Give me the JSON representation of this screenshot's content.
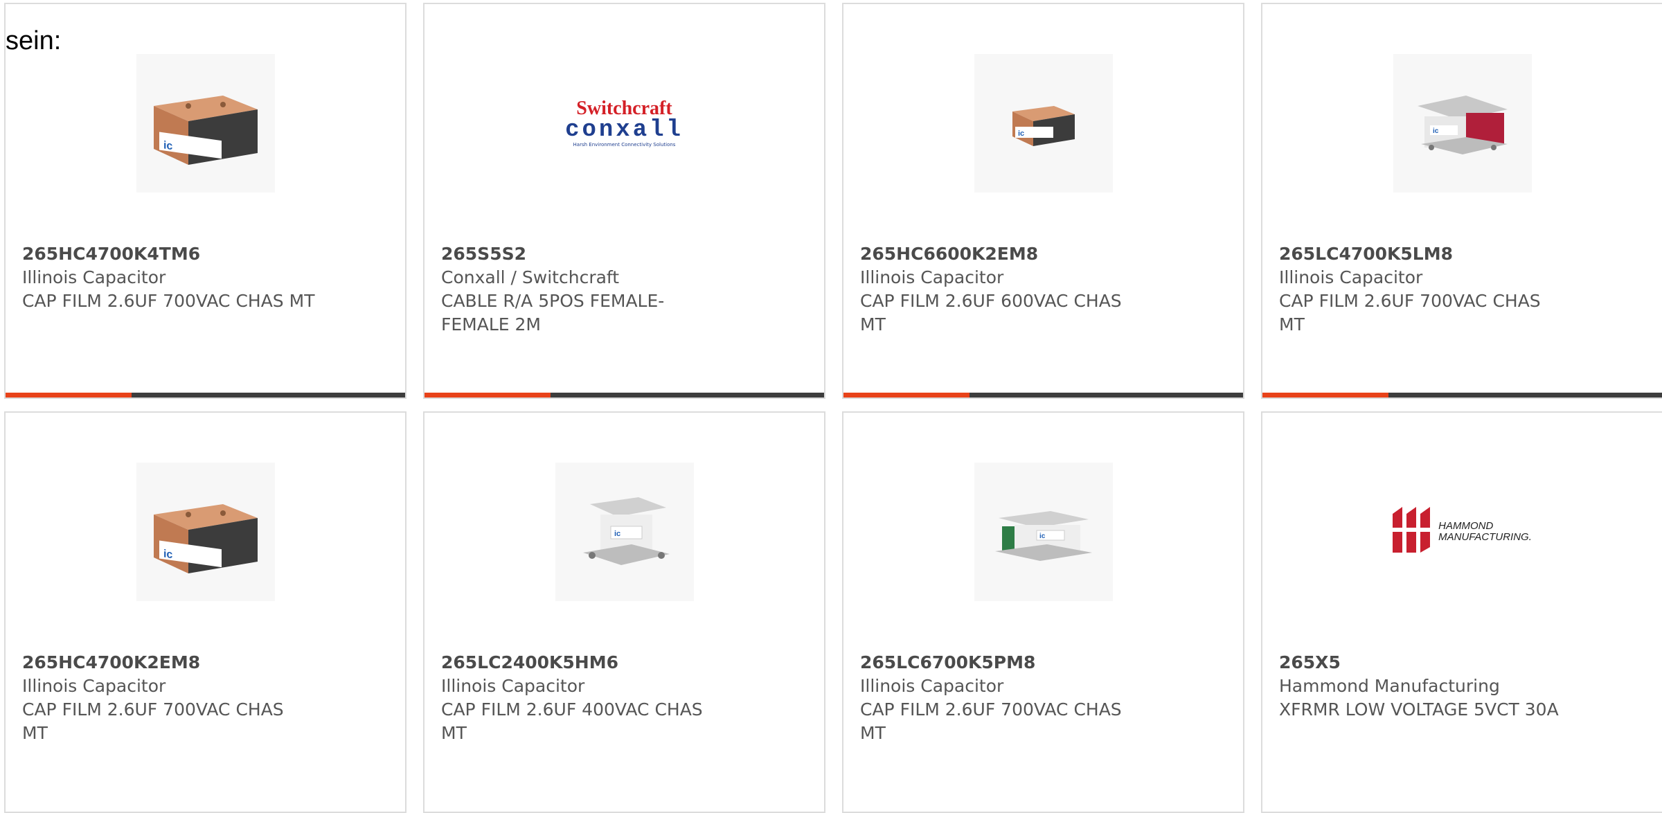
{
  "intro_text": "sein:",
  "cards": [
    {
      "part": "265HC4700K4TM6",
      "mfr": "Illinois Capacitor",
      "desc": "CAP FILM 2.6UF 700VAC CHAS MT",
      "image": "copper-capacitor-image"
    },
    {
      "part": "265S5S2",
      "mfr": "Conxall / Switchcraft",
      "desc": "CABLE R/A 5POS FEMALE-FEMALE 2M",
      "image": "switchcraft-conxall-logo",
      "logo": {
        "line1": "Switchcraft",
        "line2": "conxall",
        "tagline": "Harsh Environment Connectivity Solutions"
      }
    },
    {
      "part": "265HC6600K2EM8",
      "mfr": "Illinois Capacitor",
      "desc": "CAP FILM 2.6UF 600VAC CHAS MT",
      "image": "copper-capacitor-small-image"
    },
    {
      "part": "265LC4700K5LM8",
      "mfr": "Illinois Capacitor",
      "desc": "CAP FILM 2.6UF 700VAC CHAS MT",
      "image": "capacitor-red-image"
    },
    {
      "part": "265HC4700K2EM8",
      "mfr": "Illinois Capacitor",
      "desc": "CAP FILM 2.6UF 700VAC CHAS MT",
      "image": "copper-capacitor-image"
    },
    {
      "part": "265LC2400K5HM6",
      "mfr": "Illinois Capacitor",
      "desc": "CAP FILM 2.6UF 400VAC CHAS MT",
      "image": "capacitor-silver-image"
    },
    {
      "part": "265LC6700K5PM8",
      "mfr": "Illinois Capacitor",
      "desc": "CAP FILM 2.6UF 700VAC CHAS MT",
      "image": "capacitor-green-image"
    },
    {
      "part": "265X5",
      "mfr": "Hammond Manufacturing",
      "desc": "XFRMR LOW VOLTAGE 5VCT 30A",
      "image": "hammond-logo",
      "logo": {
        "line1": "HAMMOND",
        "line2": "MANUFACTURING."
      }
    }
  ],
  "colors": {
    "accent": "#e8431a",
    "bar": "#3d3d3d",
    "border": "#dcdcdc",
    "copper": "#c9875c",
    "label_blue": "#1f5fb5"
  }
}
